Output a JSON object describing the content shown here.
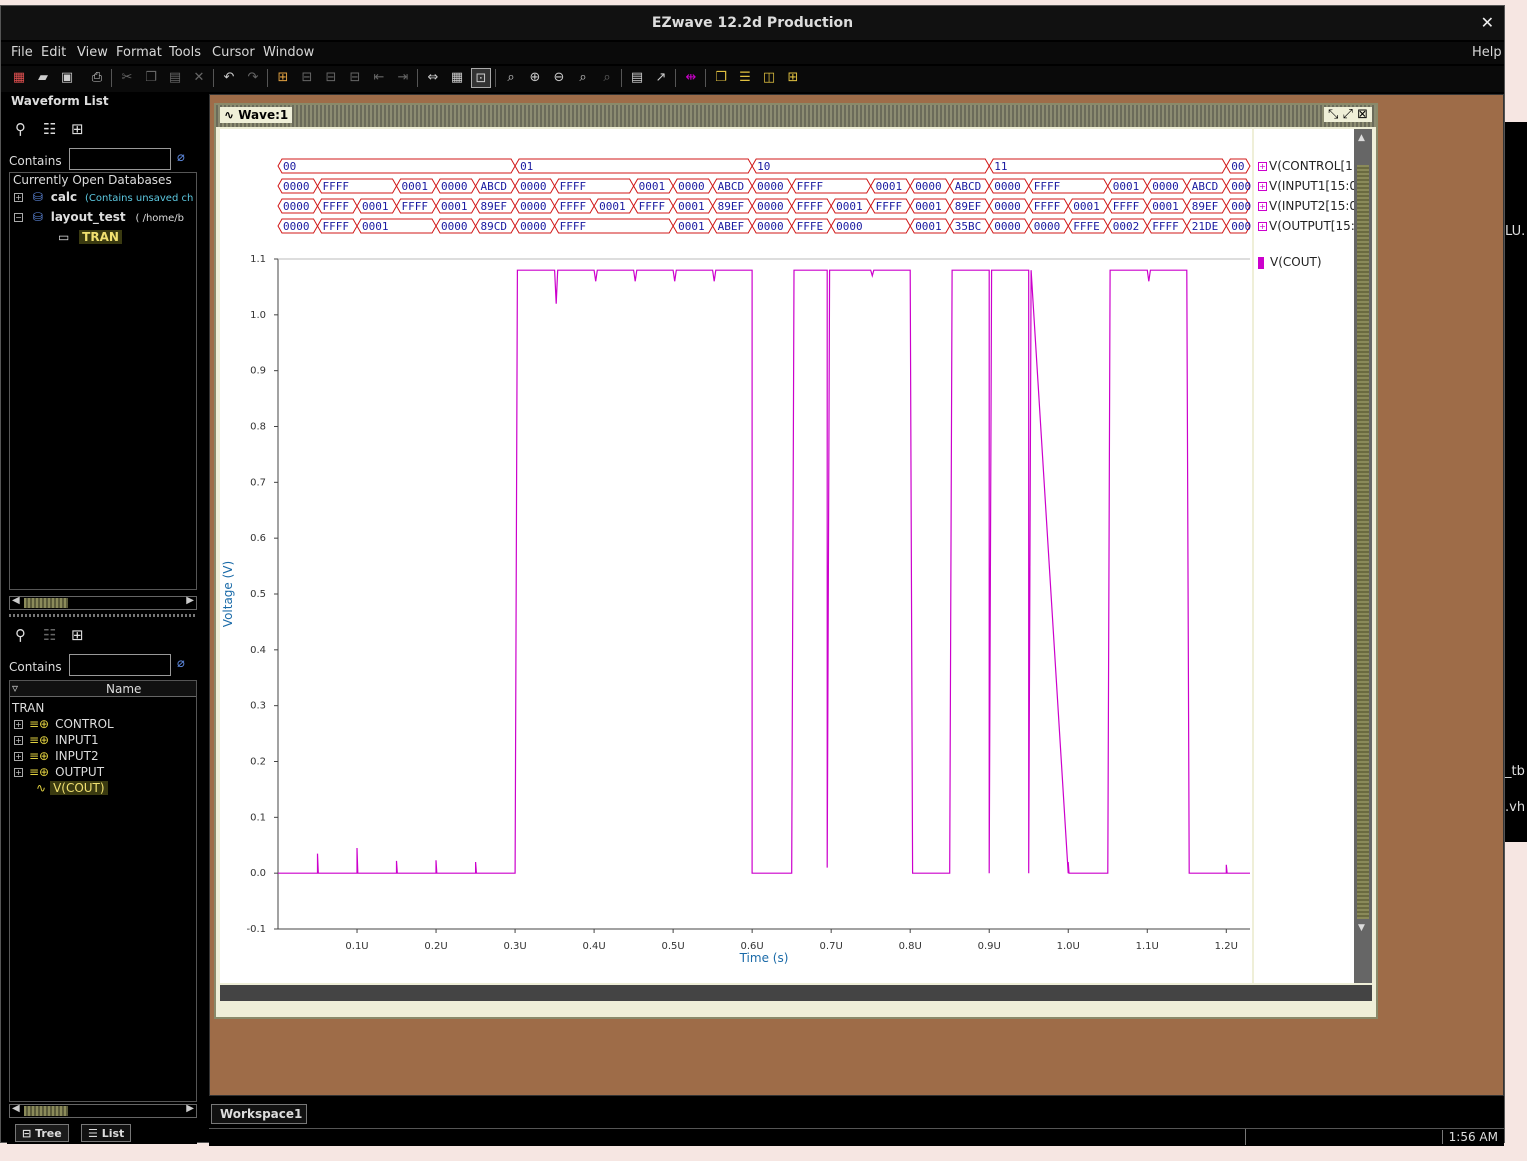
{
  "window": {
    "title": "EZwave 12.2d Production",
    "close": "✕"
  },
  "menu": {
    "file": "File",
    "edit": "Edit",
    "view": "View",
    "format": "Format",
    "tools": "Tools",
    "cursor": "Cursor",
    "window": "Window",
    "help": "Help"
  },
  "waveform_list": {
    "title": "Waveform List",
    "contains_label": "Contains",
    "header": "Currently Open Databases",
    "db1_name": "calc",
    "db1_note": "(Contains unsaved ch",
    "db2_name": "layout_test",
    "db2_path": "( /home/b",
    "db2_child": "TRAN"
  },
  "signal_list": {
    "contains_label": "Contains",
    "col_name": "Name",
    "root": "TRAN",
    "items": [
      "CONTROL",
      "INPUT1",
      "INPUT2",
      "OUTPUT",
      "V(COUT)"
    ]
  },
  "tabs": {
    "tree": "Tree",
    "list": "List",
    "workspace": "Workspace1"
  },
  "wave_window": {
    "title": "Wave:1"
  },
  "status": {
    "clock": "1:56 AM"
  },
  "right_edge": {
    "t1": "LU.",
    "t2": "_tb",
    "t3": ".vh"
  },
  "colors": {
    "trace": "#cc00cc",
    "bus": "#d01818",
    "bus_text": "#1a1aa0",
    "workspace": "#9e6c48"
  },
  "chart_data": {
    "type": "line",
    "xlabel": "Time (s)",
    "ylabel": "Voltage (V)",
    "xlim": [
      0,
      1.23
    ],
    "ylim": [
      -0.1,
      1.1
    ],
    "xticks": [
      "0.1U",
      "0.2U",
      "0.3U",
      "0.4U",
      "0.5U",
      "0.6U",
      "0.7U",
      "0.8U",
      "0.9U",
      "1.0U",
      "1.1U",
      "1.2U"
    ],
    "yticks": [
      "-0.1",
      "0.0",
      "0.1",
      "0.2",
      "0.3",
      "0.4",
      "0.5",
      "0.6",
      "0.7",
      "0.8",
      "0.9",
      "1.0",
      "1.1"
    ],
    "series": [
      {
        "name": "V(COUT)",
        "color": "#cc00cc",
        "x": [
          0,
          0.05,
          0.05,
          0.051,
          0.1,
          0.1,
          0.101,
          0.15,
          0.15,
          0.151,
          0.2,
          0.2,
          0.201,
          0.25,
          0.25,
          0.251,
          0.3,
          0.303,
          0.35,
          0.352,
          0.354,
          0.4,
          0.402,
          0.404,
          0.45,
          0.452,
          0.454,
          0.5,
          0.502,
          0.504,
          0.55,
          0.552,
          0.554,
          0.6,
          0.6,
          0.603,
          0.65,
          0.653,
          0.695,
          0.695,
          0.698,
          0.7,
          0.703,
          0.75,
          0.752,
          0.754,
          0.8,
          0.803,
          0.85,
          0.853,
          0.9,
          0.9,
          0.903,
          0.95,
          0.95,
          0.953,
          1.0,
          1.0,
          1.001,
          1.05,
          1.053,
          1.1,
          1.102,
          1.104,
          1.15,
          1.153,
          1.2,
          1.2,
          1.201,
          1.23
        ],
        "y": [
          0,
          0,
          0.035,
          0,
          0,
          0.045,
          0,
          0,
          0.022,
          0,
          0,
          0.023,
          0,
          0,
          0.02,
          0,
          0,
          1.08,
          1.08,
          1.02,
          1.08,
          1.08,
          1.06,
          1.08,
          1.08,
          1.06,
          1.08,
          1.08,
          1.06,
          1.08,
          1.08,
          1.06,
          1.08,
          1.08,
          0.0,
          0,
          0,
          1.08,
          1.08,
          0.01,
          1.08,
          1.08,
          1.08,
          1.08,
          1.07,
          1.08,
          1.08,
          0,
          0,
          1.08,
          1.08,
          0.0,
          1.08,
          1.08,
          0.0,
          1.08,
          0,
          0.02,
          0,
          0,
          1.08,
          1.08,
          1.06,
          1.08,
          1.08,
          0,
          0,
          0.015,
          0,
          0
        ]
      }
    ],
    "buses": [
      {
        "name": "V(CONTROL[1:",
        "segments": [
          [
            "00",
            0,
            0.3
          ],
          [
            "01",
            0.3,
            0.6
          ],
          [
            "10",
            0.6,
            0.9
          ],
          [
            "11",
            0.9,
            1.2
          ],
          [
            "00",
            1.2,
            1.23
          ]
        ]
      },
      {
        "name": "V(INPUT1[15:0",
        "segments": [
          [
            "0000",
            0,
            0.05
          ],
          [
            "FFFF",
            0.05,
            0.15
          ],
          [
            "0001",
            0.15,
            0.2
          ],
          [
            "0000",
            0.2,
            0.25
          ],
          [
            "ABCD",
            0.25,
            0.3
          ],
          [
            "0000",
            0.3,
            0.35
          ],
          [
            "FFFF",
            0.35,
            0.45
          ],
          [
            "0001",
            0.45,
            0.5
          ],
          [
            "0000",
            0.5,
            0.55
          ],
          [
            "ABCD",
            0.55,
            0.6
          ],
          [
            "0000",
            0.6,
            0.65
          ],
          [
            "FFFF",
            0.65,
            0.75
          ],
          [
            "0001",
            0.75,
            0.8
          ],
          [
            "0000",
            0.8,
            0.85
          ],
          [
            "ABCD",
            0.85,
            0.9
          ],
          [
            "0000",
            0.9,
            0.95
          ],
          [
            "FFFF",
            0.95,
            1.05
          ],
          [
            "0001",
            1.05,
            1.1
          ],
          [
            "0000",
            1.1,
            1.15
          ],
          [
            "ABCD",
            1.15,
            1.2
          ],
          [
            "000",
            1.2,
            1.23
          ]
        ]
      },
      {
        "name": "V(INPUT2[15:0",
        "segments": [
          [
            "0000",
            0,
            0.05
          ],
          [
            "FFFF",
            0.05,
            0.1
          ],
          [
            "0001",
            0.1,
            0.15
          ],
          [
            "FFFF",
            0.15,
            0.2
          ],
          [
            "0001",
            0.2,
            0.25
          ],
          [
            "89EF",
            0.25,
            0.3
          ],
          [
            "0000",
            0.3,
            0.35
          ],
          [
            "FFFF",
            0.35,
            0.4
          ],
          [
            "0001",
            0.4,
            0.45
          ],
          [
            "FFFF",
            0.45,
            0.5
          ],
          [
            "0001",
            0.5,
            0.55
          ],
          [
            "89EF",
            0.55,
            0.6
          ],
          [
            "0000",
            0.6,
            0.65
          ],
          [
            "FFFF",
            0.65,
            0.7
          ],
          [
            "0001",
            0.7,
            0.75
          ],
          [
            "FFFF",
            0.75,
            0.8
          ],
          [
            "0001",
            0.8,
            0.85
          ],
          [
            "89EF",
            0.85,
            0.9
          ],
          [
            "0000",
            0.9,
            0.95
          ],
          [
            "FFFF",
            0.95,
            1.0
          ],
          [
            "0001",
            1.0,
            1.05
          ],
          [
            "FFFF",
            1.05,
            1.1
          ],
          [
            "0001",
            1.1,
            1.15
          ],
          [
            "89EF",
            1.15,
            1.2
          ],
          [
            "000",
            1.2,
            1.23
          ]
        ]
      },
      {
        "name": "V(OUTPUT[15:",
        "segments": [
          [
            "0000",
            0,
            0.05
          ],
          [
            "FFFF",
            0.05,
            0.1
          ],
          [
            "0001",
            0.1,
            0.2
          ],
          [
            "0000",
            0.2,
            0.25
          ],
          [
            "89CD",
            0.25,
            0.3
          ],
          [
            "0000",
            0.3,
            0.35
          ],
          [
            "FFFF",
            0.35,
            0.5
          ],
          [
            "0001",
            0.5,
            0.55
          ],
          [
            "ABEF",
            0.55,
            0.6
          ],
          [
            "0000",
            0.6,
            0.65
          ],
          [
            "FFFE",
            0.65,
            0.7
          ],
          [
            "0000",
            0.7,
            0.8
          ],
          [
            "0001",
            0.8,
            0.85
          ],
          [
            "35BC",
            0.85,
            0.9
          ],
          [
            "0000",
            0.9,
            0.95
          ],
          [
            "0000",
            0.95,
            1.0
          ],
          [
            "FFFE",
            1.0,
            1.05
          ],
          [
            "0002",
            1.05,
            1.1
          ],
          [
            "FFFF",
            1.1,
            1.15
          ],
          [
            "21DE",
            1.15,
            1.2
          ],
          [
            "000",
            1.2,
            1.23
          ]
        ]
      }
    ]
  }
}
